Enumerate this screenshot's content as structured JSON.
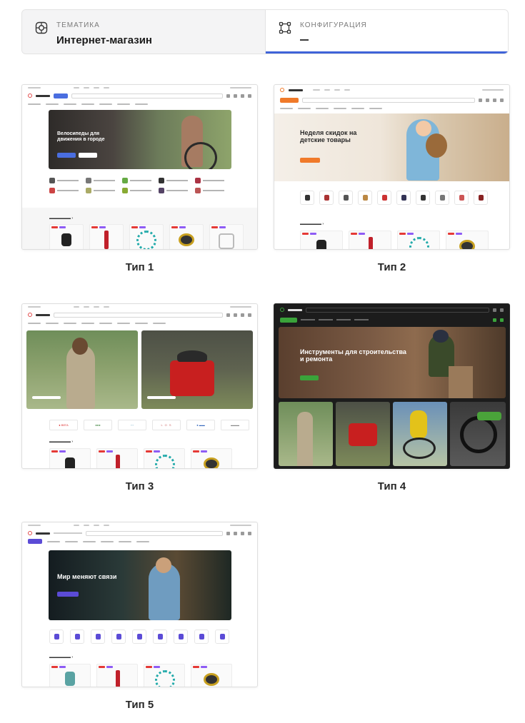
{
  "tabs": {
    "theme": {
      "caption": "Тематика",
      "value": "Интернет-магазин"
    },
    "config": {
      "caption": "Конфигурация",
      "value": "—"
    }
  },
  "cards": [
    {
      "label": "Тип 1",
      "hero_title": "Велосипеды для движения в городе"
    },
    {
      "label": "Тип 2",
      "hero_title": "Неделя скидок на детские товары"
    },
    {
      "label": "Тип 3",
      "hero_title": ""
    },
    {
      "label": "Тип 4",
      "hero_title": "Инструменты для строительства и ремонта"
    },
    {
      "label": "Тип 5",
      "hero_title": "Мир меняют связи"
    }
  ],
  "colors": {
    "accent": "#3f63d8",
    "brand_red": "#e24b4b",
    "orange": "#f07a2a",
    "dark_bg": "#1c1c1c",
    "green": "#3aa33a",
    "purple": "#5b4bd6"
  }
}
